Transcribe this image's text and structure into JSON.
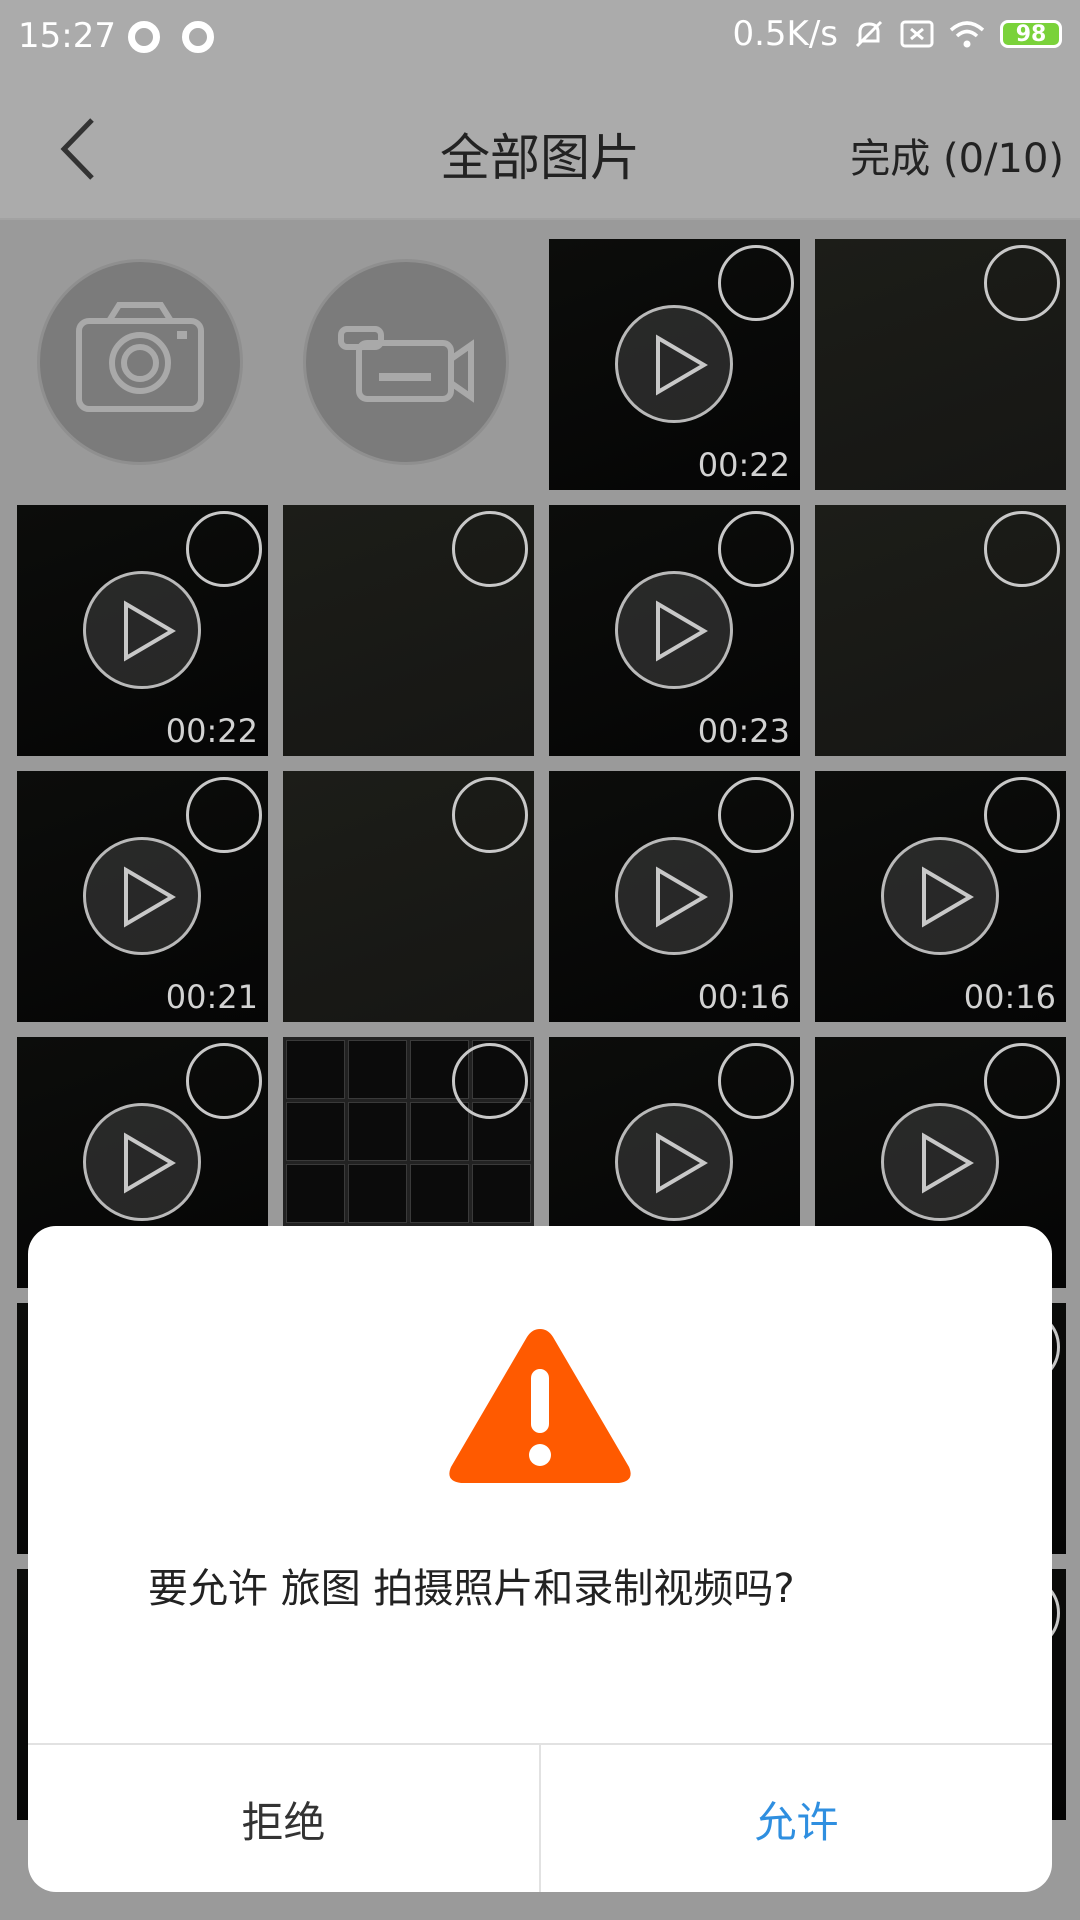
{
  "status_bar": {
    "time": "15:27",
    "network_speed": "0.5K/s",
    "battery": "98",
    "icons": [
      "record-dot-icon",
      "record-dot-icon",
      "mute-bell-icon",
      "sim-off-icon",
      "wifi-icon",
      "battery-icon"
    ]
  },
  "header": {
    "back_icon": "chevron-left-icon",
    "title": "全部图片",
    "done_label": "完成 (0/10)"
  },
  "grid": {
    "camera_icon": "camera-icon",
    "video_camera_icon": "video-camera-icon",
    "items": [
      {
        "type": "video",
        "duration": "00:22"
      },
      {
        "type": "photo",
        "duration": ""
      },
      {
        "type": "video",
        "duration": "00:22"
      },
      {
        "type": "photo",
        "duration": ""
      },
      {
        "type": "video",
        "duration": "00:23"
      },
      {
        "type": "photo",
        "duration": ""
      },
      {
        "type": "video",
        "duration": "00:21"
      },
      {
        "type": "photo",
        "duration": ""
      },
      {
        "type": "video",
        "duration": "00:16"
      },
      {
        "type": "video",
        "duration": "00:16"
      },
      {
        "type": "video",
        "duration": ""
      },
      {
        "type": "collage",
        "duration": ""
      },
      {
        "type": "video",
        "duration": ""
      },
      {
        "type": "video",
        "duration": ""
      }
    ]
  },
  "dialog": {
    "icon": "warning-icon",
    "icon_color": "#ff5a00",
    "message": "要允许 旅图 拍摄照片和录制视频吗?",
    "deny_label": "拒绝",
    "allow_label": "允许",
    "allow_color": "#2f8fe0"
  }
}
